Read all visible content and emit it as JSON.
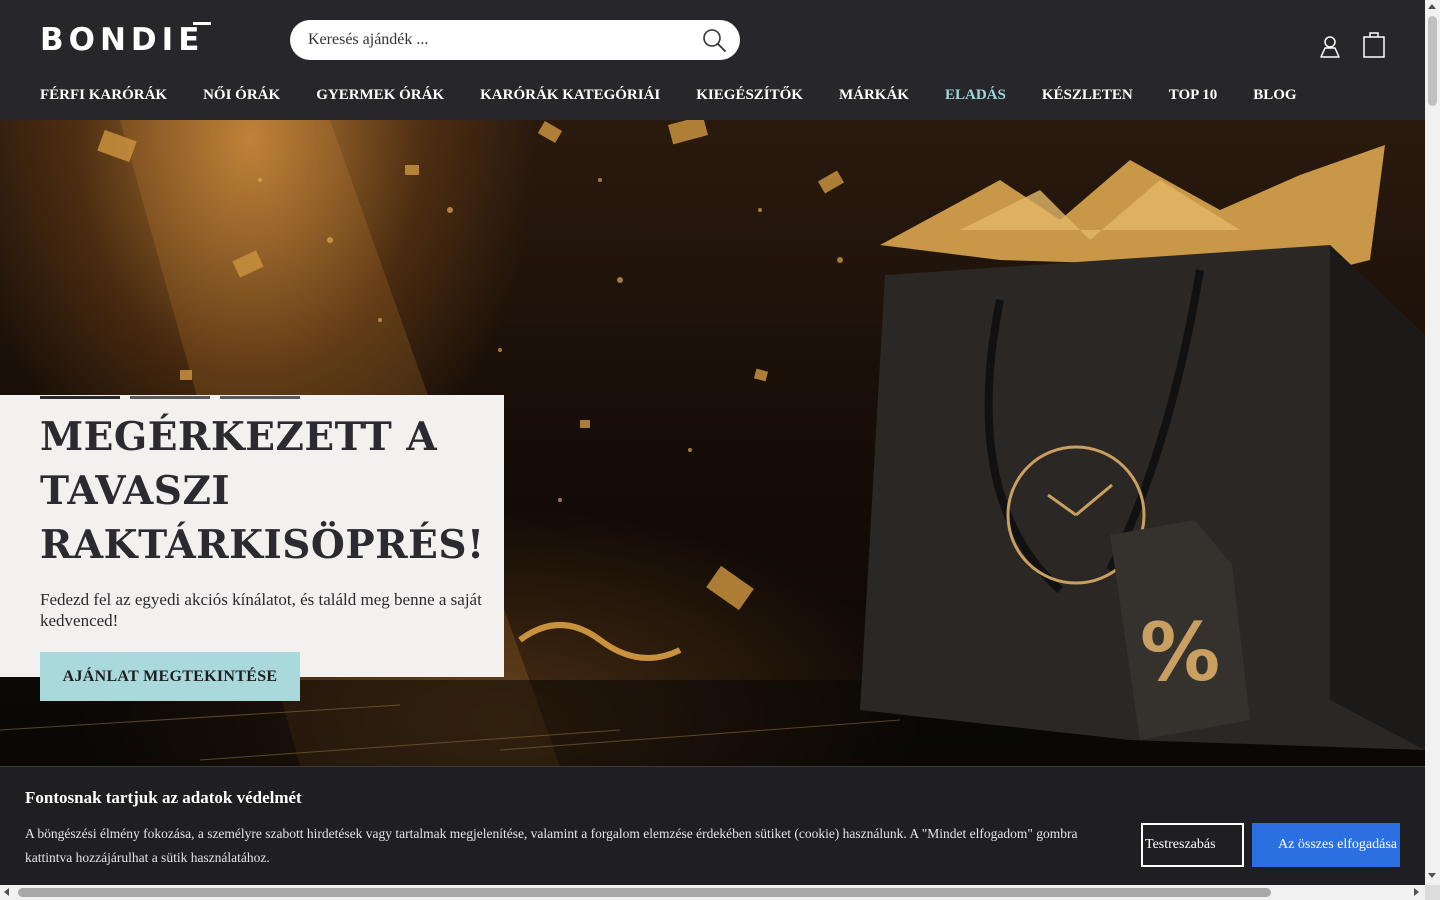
{
  "brand": {
    "logo": "BONDIE"
  },
  "search": {
    "placeholder": "Keresés ajándék ..."
  },
  "icons": {
    "search": "search-icon",
    "user": "user-icon",
    "cart": "shopping-bag-icon"
  },
  "nav": {
    "items": [
      {
        "label": "FÉRFI KARÓRÁK"
      },
      {
        "label": "NŐI ÓRÁK"
      },
      {
        "label": "GYERMEK ÓRÁK"
      },
      {
        "label": "KARÓRÁK KATEGÓRIÁI"
      },
      {
        "label": "KIEGÉSZÍTŐK"
      },
      {
        "label": "MÁRKÁK"
      },
      {
        "label": "ELADÁS",
        "active": true
      },
      {
        "label": "KÉSZLETEN"
      },
      {
        "label": "TOP 10"
      },
      {
        "label": "BLOG"
      }
    ]
  },
  "hero": {
    "title": "MEGÉRKEZETT A TAVASZI RAKTÁRKISÖPRÉS!",
    "subtitle": "Fedezd fel az egyedi akciós kínálatot, és találd meg benne a saját kedvenced!",
    "cta": "AJÁNLAT MEGTEKINTÉSE",
    "slides_total": 3,
    "slide_active": 1
  },
  "cookie": {
    "title": "Fontosnak tartjuk az adatok védelmét",
    "text": "A böngészési élmény fokozása, a személyre szabott hirdetések vagy tartalmak megjelenítése, valamint a forgalom elemzése érdekében sütiket (cookie) használunk. A \"Mindet elfogadom\" gombra kattintva hozzájárulhat a sütik használatához.",
    "customize": "Testreszabás",
    "accept": "Az összes elfogadása"
  },
  "colors": {
    "header_bg": "#27262b",
    "nav_active": "#9fd8db",
    "cta_bg": "#aad9db",
    "accept_bg": "#2c6fe0",
    "cookie_bg": "#1f1e23"
  }
}
